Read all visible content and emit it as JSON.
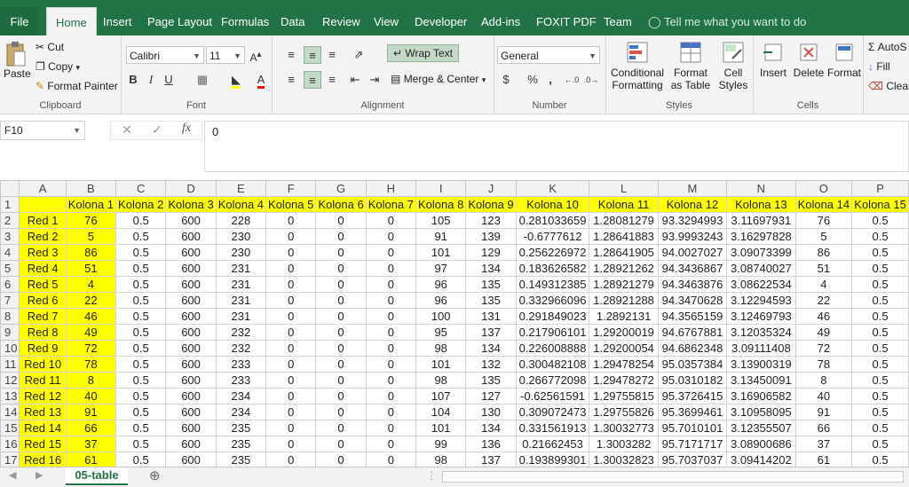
{
  "ribbon_tabs": [
    "File",
    "Home",
    "Insert",
    "Page Layout",
    "Formulas",
    "Data",
    "Review",
    "View",
    "Developer",
    "Add-ins",
    "FOXIT PDF",
    "Team"
  ],
  "tell_me": "Tell me what you want to do",
  "clipboard": {
    "paste": "Paste",
    "cut": "Cut",
    "copy": "Copy",
    "format_painter": "Format Painter",
    "label": "Clipboard"
  },
  "font": {
    "name": "Calibri",
    "size": "11",
    "label": "Font"
  },
  "alignment": {
    "wrap": "Wrap Text",
    "merge": "Merge & Center",
    "label": "Alignment"
  },
  "number": {
    "format": "General",
    "label": "Number",
    "currency": "$",
    "percent": "%",
    "comma": ","
  },
  "styles": {
    "conditional": "Conditional Formatting",
    "format_table": "Format as Table",
    "cell_styles": "Cell Styles",
    "label": "Styles"
  },
  "cells": {
    "insert": "Insert",
    "delete": "Delete",
    "format": "Format",
    "label": "Cells"
  },
  "editing": {
    "autosum": "AutoS",
    "fill": "Fill",
    "clear": "Clear"
  },
  "name_box": "F10",
  "formula_value": "0",
  "columns": [
    "A",
    "B",
    "C",
    "D",
    "E",
    "F",
    "G",
    "H",
    "I",
    "J",
    "K",
    "L",
    "M",
    "N",
    "O",
    "P"
  ],
  "header_row": [
    "",
    "Kolona 1",
    "Kolona 2",
    "Kolona 3",
    "Kolona 4",
    "Kolona 5",
    "Kolona 6",
    "Kolona 7",
    "Kolona 8",
    "Kolona 9",
    "Kolona 10",
    "Kolona 11",
    "Kolona 12",
    "Kolona 13",
    "Kolona 14",
    "Kolona 15"
  ],
  "rows": [
    [
      "Red 1",
      "76",
      "0.5",
      "600",
      "228",
      "0",
      "0",
      "0",
      "105",
      "123",
      "0.281033659",
      "1.28081279",
      "93.3294993",
      "3.11697931",
      "76",
      "0.5"
    ],
    [
      "Red 2",
      "5",
      "0.5",
      "600",
      "230",
      "0",
      "0",
      "0",
      "91",
      "139",
      "-0.6777612",
      "1.28641883",
      "93.9993243",
      "3.16297828",
      "5",
      "0.5"
    ],
    [
      "Red 3",
      "86",
      "0.5",
      "600",
      "230",
      "0",
      "0",
      "0",
      "101",
      "129",
      "0.256226972",
      "1.28641905",
      "94.0027027",
      "3.09073399",
      "86",
      "0.5"
    ],
    [
      "Red 4",
      "51",
      "0.5",
      "600",
      "231",
      "0",
      "0",
      "0",
      "97",
      "134",
      "0.183626582",
      "1.28921262",
      "94.3436867",
      "3.08740027",
      "51",
      "0.5"
    ],
    [
      "Red 5",
      "4",
      "0.5",
      "600",
      "231",
      "0",
      "0",
      "0",
      "96",
      "135",
      "0.149312385",
      "1.28921279",
      "94.3463876",
      "3.08622534",
      "4",
      "0.5"
    ],
    [
      "Red 6",
      "22",
      "0.5",
      "600",
      "231",
      "0",
      "0",
      "0",
      "96",
      "135",
      "0.332966096",
      "1.28921288",
      "94.3470628",
      "3.12294593",
      "22",
      "0.5"
    ],
    [
      "Red 7",
      "46",
      "0.5",
      "600",
      "231",
      "0",
      "0",
      "0",
      "100",
      "131",
      "0.291849023",
      "1.2892131",
      "94.3565159",
      "3.12469793",
      "46",
      "0.5"
    ],
    [
      "Red 8",
      "49",
      "0.5",
      "600",
      "232",
      "0",
      "0",
      "0",
      "95",
      "137",
      "0.217906101",
      "1.29200019",
      "94.6767881",
      "3.12035324",
      "49",
      "0.5"
    ],
    [
      "Red 9",
      "72",
      "0.5",
      "600",
      "232",
      "0",
      "0",
      "0",
      "98",
      "134",
      "0.226008888",
      "1.29200054",
      "94.6862348",
      "3.09111408",
      "72",
      "0.5"
    ],
    [
      "Red 10",
      "78",
      "0.5",
      "600",
      "233",
      "0",
      "0",
      "0",
      "101",
      "132",
      "0.300482108",
      "1.29478254",
      "95.0357384",
      "3.13900319",
      "78",
      "0.5"
    ],
    [
      "Red 11",
      "8",
      "0.5",
      "600",
      "233",
      "0",
      "0",
      "0",
      "98",
      "135",
      "0.266772098",
      "1.29478272",
      "95.0310182",
      "3.13450091",
      "8",
      "0.5"
    ],
    [
      "Red 12",
      "40",
      "0.5",
      "600",
      "234",
      "0",
      "0",
      "0",
      "107",
      "127",
      "-0.62561591",
      "1.29755815",
      "95.3726415",
      "3.16906582",
      "40",
      "0.5"
    ],
    [
      "Red 13",
      "91",
      "0.5",
      "600",
      "234",
      "0",
      "0",
      "0",
      "104",
      "130",
      "0.309072473",
      "1.29755826",
      "95.3699461",
      "3.10958095",
      "91",
      "0.5"
    ],
    [
      "Red 14",
      "66",
      "0.5",
      "600",
      "235",
      "0",
      "0",
      "0",
      "101",
      "134",
      "0.331561913",
      "1.30032773",
      "95.7010101",
      "3.12355507",
      "66",
      "0.5"
    ],
    [
      "Red 15",
      "37",
      "0.5",
      "600",
      "235",
      "0",
      "0",
      "0",
      "99",
      "136",
      "0.21662453",
      "1.3003282",
      "95.7171717",
      "3.08900686",
      "37",
      "0.5"
    ],
    [
      "Red 16",
      "61",
      "0.5",
      "600",
      "235",
      "0",
      "0",
      "0",
      "98",
      "137",
      "0.193899301",
      "1.30032823",
      "95.7037037",
      "3.09414202",
      "61",
      "0.5"
    ]
  ],
  "sheet_tab": "05-table",
  "colors": {
    "excel_green": "#217346",
    "highlight": "#ffff00"
  }
}
